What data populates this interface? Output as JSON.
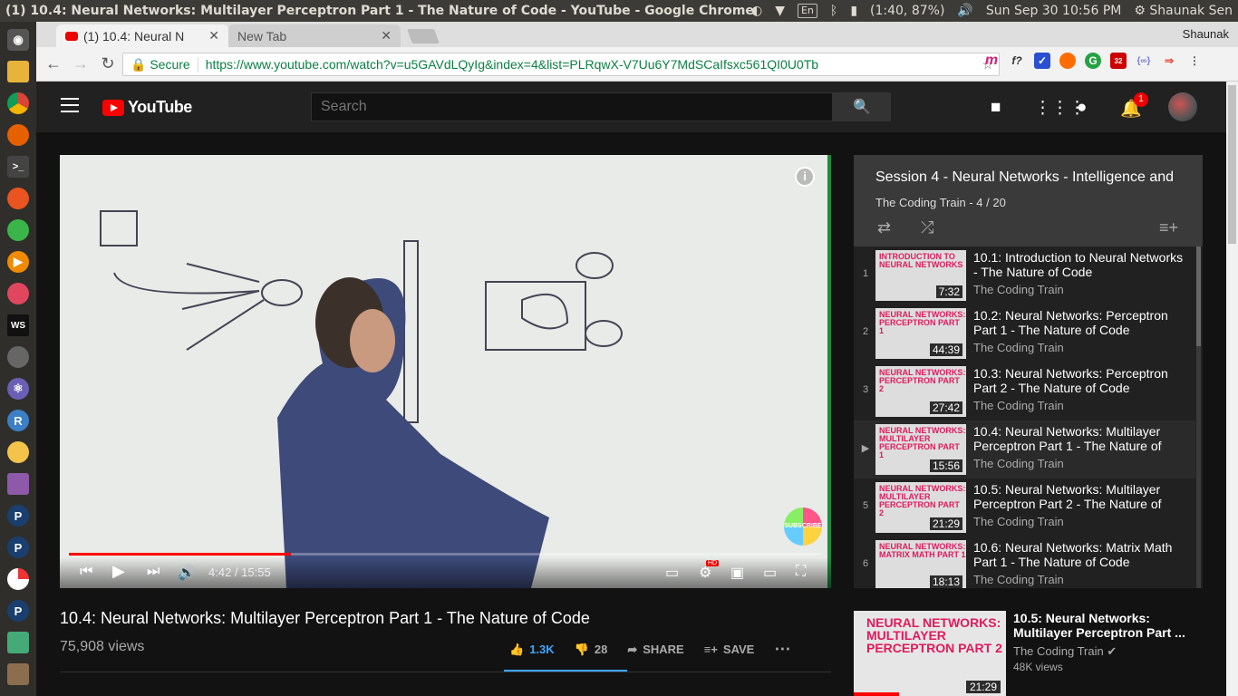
{
  "os": {
    "window_title": "(1) 10.4: Neural Networks: Multilayer Perceptron Part 1 - The Nature of Code - YouTube - Google Chrome",
    "tray": {
      "keyboard": "En",
      "battery": "(1:40, 87%)",
      "datetime": "Sun Sep 30 10:56 PM",
      "user": "Shaunak Sen"
    },
    "launcher_icons": [
      "dash-icon",
      "files-icon",
      "chrome-icon",
      "firefox-icon",
      "terminal-icon",
      "software-icon",
      "settings-icon",
      "vlc-icon",
      "app-icon",
      "webstorm-icon",
      "disks-icon",
      "atom-icon",
      "rstudio-icon",
      "weather-icon",
      "document-icon",
      "p-app-icon",
      "p-app-icon",
      "pie-app-icon",
      "p-app-icon",
      "tool-icon",
      "trash-icon"
    ],
    "launcher_letters": {
      "webstorm": "WS",
      "rstudio": "R",
      "p": "P"
    }
  },
  "browser": {
    "tabs": [
      {
        "label": "(1) 10.4: Neural N"
      },
      {
        "label": "New Tab"
      }
    ],
    "profile": "Shaunak",
    "secure_label": "Secure",
    "url": "https://www.youtube.com/watch?v=u5GAVdLQyIg&index=4&list=PLRqwX-V7Uu6Y7MdSCaIfsxc561QI0U0Tb",
    "ext_badge": "32",
    "ext_labels": {
      "m": "m",
      "f": "f?",
      "code": "{∞}"
    }
  },
  "youtube": {
    "logo_text": "YouTube",
    "search_placeholder": "Search",
    "notification_count": "1",
    "colors": {
      "brand_red": "#ff0000",
      "accent_blue": "#3ea6ff",
      "thumb_pink": "#e01a5e"
    }
  },
  "player": {
    "current_time": "4:42",
    "duration": "15:55",
    "progress_fraction": 0.295,
    "hd_label": "HD",
    "subscribe_label": "SUBSCRIBE"
  },
  "video": {
    "title": "10.4: Neural Networks: Multilayer Perceptron Part 1 - The Nature of Code",
    "views": "75,908 views",
    "likes": "1.3K",
    "dislikes": "28",
    "share_label": "SHARE",
    "save_label": "SAVE"
  },
  "playlist": {
    "title": "Session 4 - Neural Networks - Intelligence and",
    "subtitle": "The Coding Train - 4 / 20",
    "items": [
      {
        "index": "1",
        "thumb_text": "INTRODUCTION TO NEURAL NETWORKS",
        "title": "10.1: Introduction to Neural Networks - The Nature of Code",
        "channel": "The Coding Train",
        "duration": "7:32"
      },
      {
        "index": "2",
        "thumb_text": "NEURAL NETWORKS: PERCEPTRON PART 1",
        "title": "10.2: Neural Networks: Perceptron Part 1 - The Nature of Code",
        "channel": "The Coding Train",
        "duration": "44:39"
      },
      {
        "index": "3",
        "thumb_text": "NEURAL NETWORKS: PERCEPTRON PART 2",
        "title": "10.3: Neural Networks: Perceptron Part 2 - The Nature of Code",
        "channel": "The Coding Train",
        "duration": "27:42"
      },
      {
        "index": "▶",
        "thumb_text": "NEURAL NETWORKS: MULTILAYER PERCEPTRON PART 1",
        "title": "10.4: Neural Networks: Multilayer Perceptron Part 1 - The Nature of",
        "channel": "The Coding Train",
        "duration": "15:56"
      },
      {
        "index": "5",
        "thumb_text": "NEURAL NETWORKS: MULTILAYER PERCEPTRON PART 2",
        "title": "10.5: Neural Networks: Multilayer Perceptron Part 2 - The Nature of",
        "channel": "The Coding Train",
        "duration": "21:29"
      },
      {
        "index": "6",
        "thumb_text": "NEURAL NETWORKS: MATRIX MATH PART 1",
        "title": "10.6: Neural Networks: Matrix Math Part 1 - The Nature of Code",
        "channel": "The Coding Train",
        "duration": "18:13"
      }
    ]
  },
  "up_next": {
    "thumb_text": "NEURAL NETWORKS: MULTILAYER PERCEPTRON PART 2",
    "title": "10.5: Neural Networks: Multilayer Perceptron Part ...",
    "channel": "The Coding Train",
    "views": "48K views",
    "duration": "21:29"
  }
}
